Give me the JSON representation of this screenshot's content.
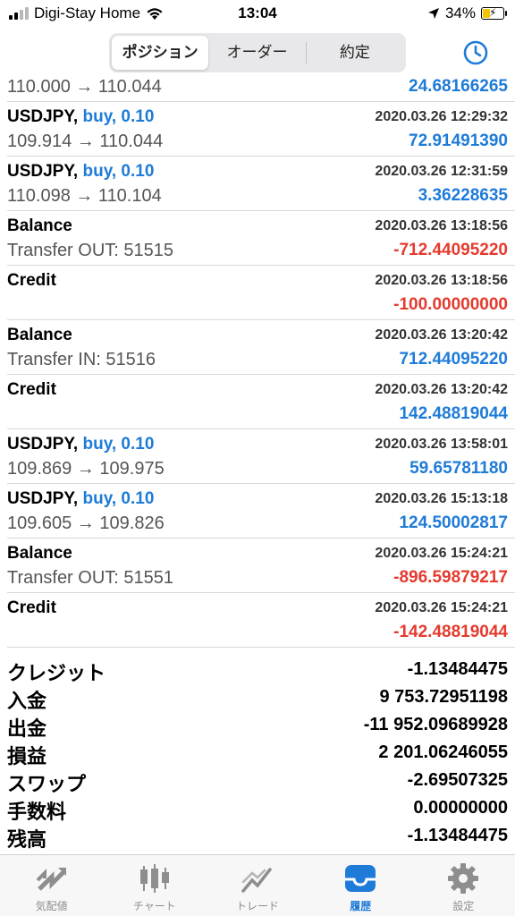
{
  "status_bar": {
    "carrier": "Digi-Stay Home",
    "time": "13:04",
    "battery": "34%"
  },
  "segments": [
    {
      "label": "ポジション",
      "active": true
    },
    {
      "label": "オーダー",
      "active": false
    },
    {
      "label": "約定",
      "active": false
    }
  ],
  "rows": [
    {
      "title": "",
      "side": "",
      "date": "",
      "detail": "110.000 → 110.044",
      "value": "24.68166265",
      "color": "blue"
    },
    {
      "title": "USDJPY,",
      "side": "buy, 0.10",
      "date": "2020.03.26 12:29:32",
      "detail": "109.914 → 110.044",
      "value": "72.91491390",
      "color": "blue"
    },
    {
      "title": "USDJPY,",
      "side": "buy, 0.10",
      "date": "2020.03.26 12:31:59",
      "detail": "110.098 → 110.104",
      "value": "3.36228635",
      "color": "blue"
    },
    {
      "title": "Balance",
      "side": "",
      "date": "2020.03.26 13:18:56",
      "detail": "Transfer OUT: 51515",
      "value": "-712.44095220",
      "color": "red"
    },
    {
      "title": "Credit",
      "side": "",
      "date": "2020.03.26 13:18:56",
      "detail": "",
      "value": "-100.00000000",
      "color": "red"
    },
    {
      "title": "Balance",
      "side": "",
      "date": "2020.03.26 13:20:42",
      "detail": "Transfer IN: 51516",
      "value": "712.44095220",
      "color": "blue"
    },
    {
      "title": "Credit",
      "side": "",
      "date": "2020.03.26 13:20:42",
      "detail": "",
      "value": "142.48819044",
      "color": "blue"
    },
    {
      "title": "USDJPY,",
      "side": "buy, 0.10",
      "date": "2020.03.26 13:58:01",
      "detail": "109.869 → 109.975",
      "value": "59.65781180",
      "color": "blue"
    },
    {
      "title": "USDJPY,",
      "side": "buy, 0.10",
      "date": "2020.03.26 15:13:18",
      "detail": "109.605 → 109.826",
      "value": "124.50002817",
      "color": "blue"
    },
    {
      "title": "Balance",
      "side": "",
      "date": "2020.03.26 15:24:21",
      "detail": "Transfer OUT: 51551",
      "value": "-896.59879217",
      "color": "red"
    },
    {
      "title": "Credit",
      "side": "",
      "date": "2020.03.26 15:24:21",
      "detail": "",
      "value": "-142.48819044",
      "color": "red"
    }
  ],
  "summary": [
    {
      "label": "クレジット",
      "value": "-1.13484475"
    },
    {
      "label": "入金",
      "value": "9 753.72951198"
    },
    {
      "label": "出金",
      "value": "-11 952.09689928"
    },
    {
      "label": "損益",
      "value": "2 201.06246055"
    },
    {
      "label": "スワップ",
      "value": "-2.69507325"
    },
    {
      "label": "手数料",
      "value": "0.00000000"
    },
    {
      "label": "残高",
      "value": "-1.13484475"
    }
  ],
  "tabs": [
    {
      "label": "気配値",
      "icon": "quotes-arrows-icon",
      "active": false
    },
    {
      "label": "チャート",
      "icon": "candlestick-chart-icon",
      "active": false
    },
    {
      "label": "トレード",
      "icon": "trade-line-icon",
      "active": false
    },
    {
      "label": "履歴",
      "icon": "history-tray-icon",
      "active": true
    },
    {
      "label": "設定",
      "icon": "gear-icon",
      "active": false
    }
  ],
  "colors": {
    "blue": "#1e7bd8",
    "red": "#e53a2e",
    "inactive_tab": "#8e8e8e"
  }
}
